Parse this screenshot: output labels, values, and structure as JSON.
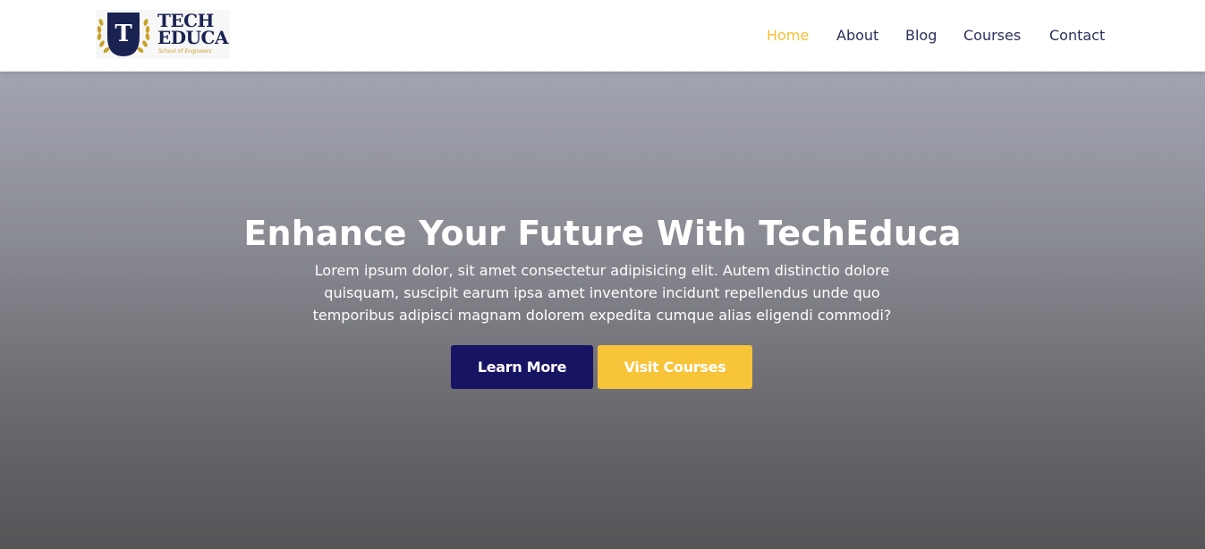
{
  "brand": {
    "line1": "TECH",
    "line2": "EDUCA",
    "tagline": "School of Engineers",
    "shield_letter": "T",
    "colors": {
      "navy": "#1a2252",
      "gold": "#c9a227"
    }
  },
  "nav": {
    "items": [
      {
        "label": "Home",
        "active": true
      },
      {
        "label": "About",
        "active": false
      },
      {
        "label": "Blog",
        "active": false
      },
      {
        "label": "Courses",
        "active": false
      },
      {
        "label": "Contact",
        "active": false
      }
    ],
    "active_color": "#f5c033",
    "text_color": "#2a2f5b"
  },
  "hero": {
    "title": "Enhance Your Future With TechEduca",
    "description": "Lorem ipsum dolor, sit amet consectetur adipisicing elit. Autem distinctio dolore quisquam, suscipit earum ipsa amet inventore incidunt repellendus unde quo temporibus adipisci magnam dolorem expedita cumque alias eligendi commodi?",
    "primary_button": {
      "label": "Learn More",
      "color": "#171463"
    },
    "secondary_button": {
      "label": "Visit Courses",
      "color": "#f8c43a"
    }
  }
}
